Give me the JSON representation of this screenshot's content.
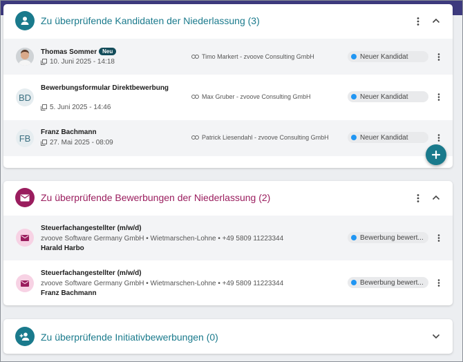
{
  "colors": {
    "teal": "#1a7a8c",
    "plum": "#9a1d5e",
    "status_dot": "#2196f3",
    "top_band": "#3d3a7e"
  },
  "candidates": {
    "title": "Zu überprüfende Kandidaten der Niederlassung (3)",
    "header_icon": "person-icon",
    "rows": [
      {
        "avatar": "photo",
        "name": "Thomas Sommer",
        "new_badge": "Neu",
        "date": "10. Juni 2025 - 14:18",
        "consultant": "Timo Markert - zvoove Consulting GmbH",
        "status": "Neuer Kandidat"
      },
      {
        "avatar": "BD",
        "name": "Bewerbungsformular Direktbewerbung",
        "date": "5. Juni 2025 - 14:46",
        "consultant": "Max Gruber - zvoove Consulting GmbH",
        "status": "Neuer Kandidat"
      },
      {
        "avatar": "FB",
        "name": "Franz Bachmann",
        "date": "27. Mai 2025 - 08:09",
        "consultant": "Patrick Liesendahl - zvoove Consulting GmbH",
        "status": "Neuer Kandidat"
      }
    ],
    "fab_icon": "plus-icon"
  },
  "applications": {
    "title": "Zu überprüfende Bewerbungen der Niederlassung (2)",
    "header_icon": "mail-icon",
    "rows": [
      {
        "job": "Steuerfachangestellter (m/w/d)",
        "company": "zvoove Software Germany GmbH • Wietmarschen-Lohne • +49 5809 11223344",
        "contact": "Harald Harbo",
        "status": "Bewerbung bewert..."
      },
      {
        "job": "Steuerfachangestellter (m/w/d)",
        "company": "zvoove Software Germany GmbH • Wietmarschen-Lohne • +49 5809 11223344",
        "contact": "Franz Bachmann",
        "status": "Bewerbung bewert..."
      }
    ]
  },
  "initiative": {
    "title": "Zu überprüfende Initiativbewerbungen (0)",
    "header_icon": "person-add-icon"
  }
}
